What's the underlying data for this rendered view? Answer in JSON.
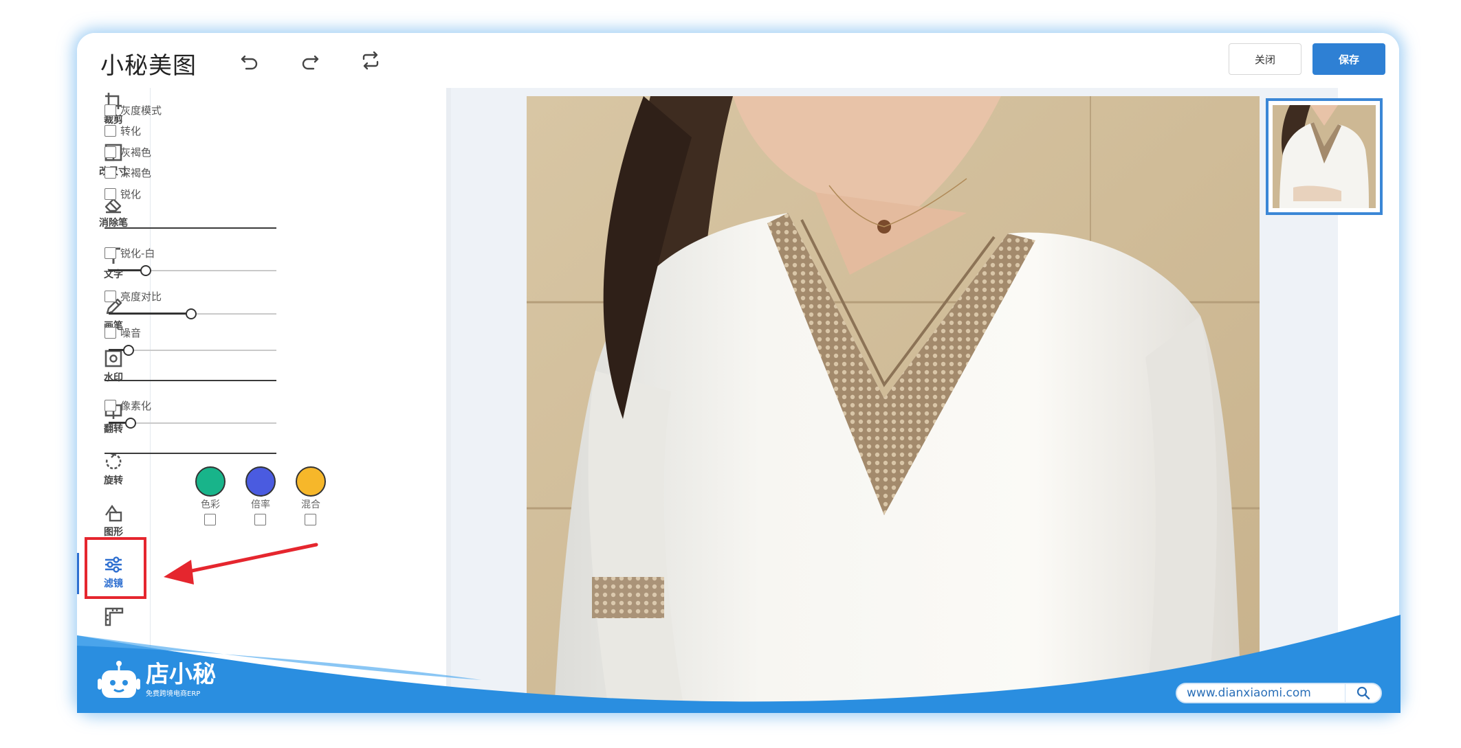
{
  "app": {
    "title": "小秘美图"
  },
  "header": {
    "close_label": "关闭",
    "save_label": "保存"
  },
  "toolbar": {
    "items": [
      {
        "label": "裁剪",
        "icon": "crop-icon"
      },
      {
        "label": "改尺寸",
        "icon": "resize-icon"
      },
      {
        "label": "消除笔",
        "icon": "eraser-icon"
      },
      {
        "label": "文字",
        "icon": "text-icon"
      },
      {
        "label": "画笔",
        "icon": "pen-icon"
      },
      {
        "label": "水印",
        "icon": "watermark-icon"
      },
      {
        "label": "翻转",
        "icon": "flip-icon"
      },
      {
        "label": "旋转",
        "icon": "rotate-icon"
      },
      {
        "label": "图形",
        "icon": "shape-icon"
      },
      {
        "label": "滤镜",
        "icon": "filter-sliders-icon",
        "active": true
      }
    ]
  },
  "filters": {
    "basic": [
      "灰度模式",
      "转化",
      "灰褐色",
      "深褐色",
      "锐化"
    ],
    "sharpen_white": {
      "label": "锐化-白",
      "value": 0.22
    },
    "brightness_contrast": {
      "label": "亮度对比",
      "value": 0.49
    },
    "noise": {
      "label": "噪音",
      "value": 0.12
    },
    "pixelate": {
      "label": "像素化",
      "value": 0.13
    },
    "color_swatches": [
      {
        "label": "色彩",
        "color": "#18b48a"
      },
      {
        "label": "倍率",
        "color": "#4a5be0"
      },
      {
        "label": "混合",
        "color": "#f6b72a"
      }
    ]
  },
  "footer": {
    "brand_name": "店小秘",
    "brand_tagline": "免费跨境电商ERP",
    "url": "www.dianxiaomi.com"
  },
  "colors": {
    "accent": "#2e80d4",
    "highlight": "#e5262e",
    "footer_blue": "#2a8ee0"
  }
}
